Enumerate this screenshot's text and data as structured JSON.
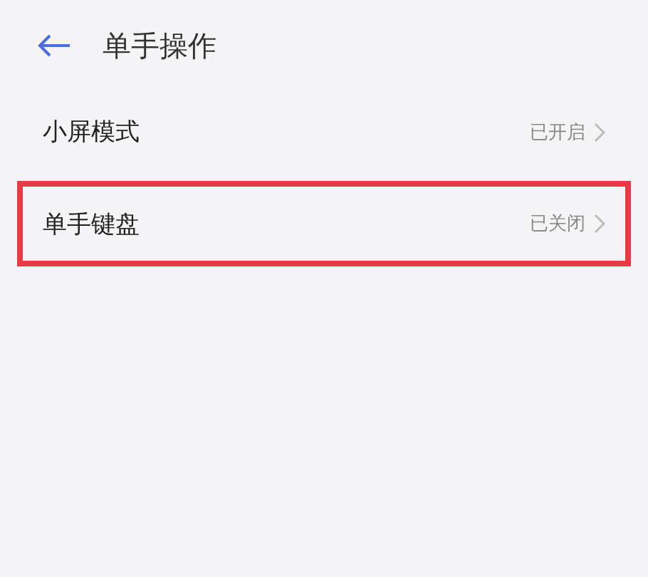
{
  "header": {
    "title": "单手操作"
  },
  "items": [
    {
      "label": "小屏模式",
      "value": "已开启",
      "highlighted": false
    },
    {
      "label": "单手键盘",
      "value": "已关闭",
      "highlighted": true
    }
  ]
}
